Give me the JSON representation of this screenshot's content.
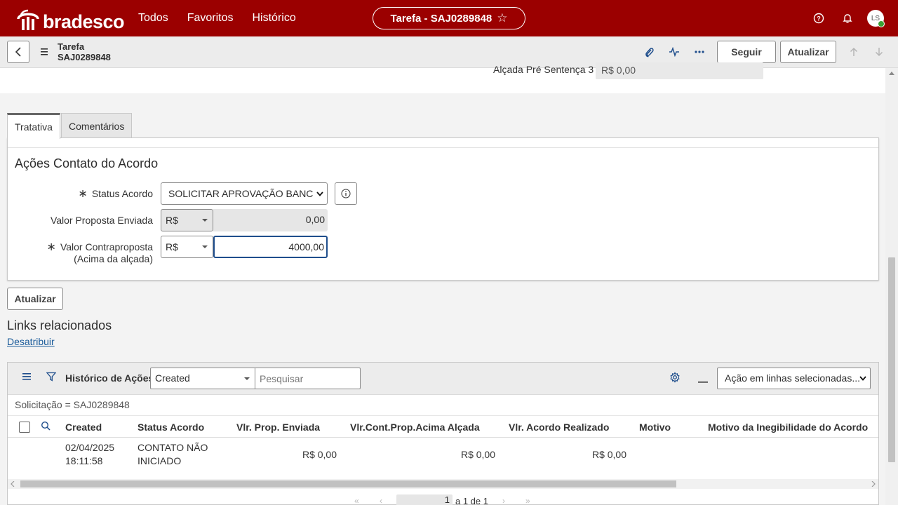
{
  "topbar": {
    "brand": "bradesco",
    "nav": [
      "Todos",
      "Favoritos",
      "Histórico"
    ],
    "record_tab": "Tarefa - SAJ0289848",
    "avatar_initials": "LS",
    "brand_color": "#9b0000"
  },
  "subheader": {
    "title_line1": "Tarefa",
    "title_line2": "SAJ0289848",
    "follow_label": "Seguir",
    "update_label": "Atualizar"
  },
  "top_field": {
    "label": "Alçada Pré Sentença 3",
    "value": "R$ 0,00"
  },
  "tabs": [
    {
      "label": "Tratativa",
      "active": true
    },
    {
      "label": "Comentários",
      "active": false
    }
  ],
  "form": {
    "section_title": "Ações Contato do Acordo",
    "status": {
      "label": "Status Acordo",
      "value": "SOLICITAR APROVAÇÃO BANCO"
    },
    "proposta": {
      "label": "Valor Proposta Enviada",
      "currency": "R$",
      "value": "0,00"
    },
    "contraproposta": {
      "label_line1": "Valor Contraproposta",
      "label_line2": "(Acima da alçada)",
      "currency": "R$",
      "value": "4000,00"
    },
    "update_label": "Atualizar"
  },
  "links": {
    "title": "Links relacionados",
    "unassign": "Desatribuir"
  },
  "grid": {
    "title": "Histórico de Ações",
    "column_select": "Created",
    "search_placeholder": "Pesquisar",
    "action_select": "Ação em linhas selecionadas...",
    "filter": "Solicitação = SAJ0289848",
    "columns": [
      "Created",
      "Status Acordo",
      "Vlr. Prop. Enviada",
      "Vlr.Cont.Prop.Acima Alçada",
      "Vlr. Acordo Realizado",
      "Motivo",
      "Motivo da Inegibilidade do Acordo"
    ],
    "rows": [
      {
        "created_date": "02/04/2025",
        "created_time": "18:11:58",
        "status_line1": "CONTATO NÃO",
        "status_line2": "INICIADO",
        "prop_enviada": "R$ 0,00",
        "cont_prop": "R$ 0,00",
        "acordo_realizado": "R$ 0,00"
      }
    ],
    "pager_page": "1",
    "pager_text": "a 1 de 1"
  }
}
